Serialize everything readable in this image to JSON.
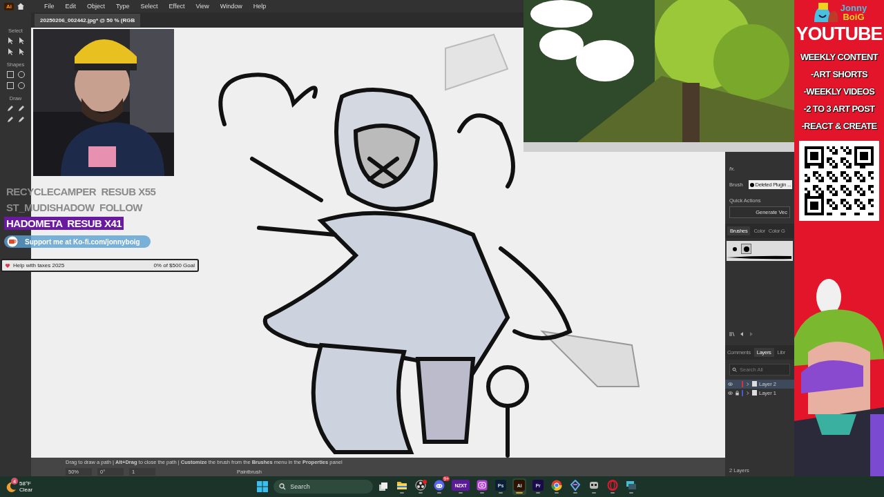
{
  "menu_bar": {
    "app_label": "Ai",
    "items": [
      "File",
      "Edit",
      "Object",
      "Type",
      "Select",
      "Effect",
      "View",
      "Window",
      "Help"
    ]
  },
  "document_tab": {
    "title": "20250206_002442.jpg* @ 50 % (RGB"
  },
  "toolbar": {
    "sections": [
      "Select",
      "Shapes",
      "Draw"
    ]
  },
  "chat_overlay": {
    "messages": [
      {
        "user": "RECYCLECAMPER",
        "action": "RESUB X55",
        "highlighted": false
      },
      {
        "user": "ST_MUDISHADOW",
        "action": "FOLLOW",
        "highlighted": false
      },
      {
        "user": "HADOMETA",
        "action": "RESUB X41",
        "highlighted": true
      }
    ]
  },
  "support_banner": {
    "text": "Support me at Ko-fi.com/jonnyboig"
  },
  "goal": {
    "title": "Help with taxes 2025",
    "progress": "0% of $500 Goal",
    "level": 0
  },
  "properties_panel": {
    "title": "fx.",
    "brush_label": "Brush",
    "brush_value": "Deleted Plugin ...",
    "quick_actions": "Quick Actions",
    "generate_button": "Generate Vec"
  },
  "brushes_panel": {
    "tabs": [
      {
        "label": "Brushes",
        "selected": true
      },
      {
        "label": "Color",
        "selected": false
      },
      {
        "label": "Color G",
        "selected": false
      }
    ],
    "swatches": [
      {
        "selected": false
      },
      {
        "selected": true
      }
    ]
  },
  "layers_panel": {
    "tabs": [
      {
        "label": "Comments",
        "selected": false
      },
      {
        "label": "Layers",
        "selected": true
      },
      {
        "label": "Libr",
        "selected": false
      }
    ],
    "search_placeholder": "Search All",
    "layers": [
      {
        "name": "Layer 2",
        "color": "#d8303c",
        "selected": true,
        "locked": false
      },
      {
        "name": "Layer 1",
        "color": "#4a58d0",
        "selected": false,
        "locked": true
      }
    ],
    "count": "2 Layers"
  },
  "status_bar": {
    "hint": "Drag to draw a path  |  **Alt+Drag** to close the path  |  **Customize** the brush from the **Brushes** menu in the **Properties** panel",
    "zoom": "50%",
    "rotation": "0°",
    "artboard": "1",
    "tool": "Paintbrush"
  },
  "banner": {
    "logo_top": "Jonny",
    "logo_bottom": "BoiG",
    "title": "YOUTUBE",
    "lines": [
      "WEEKLY CONTENT",
      "-ART SHORTS",
      "-WEEKLY VIDEOS",
      "-2 TO 3 ART POST",
      "-REACT & CREATE"
    ]
  },
  "taskbar": {
    "weather": {
      "temperature": "58°F",
      "condition": "Clear",
      "badge": "4"
    },
    "search_placeholder": "Search",
    "apps": [
      {
        "kind": "folder",
        "active": false
      },
      {
        "kind": "record",
        "active": false,
        "dot": true
      },
      {
        "kind": "chat",
        "active": false,
        "badge": "9+"
      },
      {
        "kind": "label",
        "label": "NZXT",
        "color": "#5a1a9a",
        "active": false
      },
      {
        "kind": "camera",
        "active": false
      },
      {
        "kind": "label",
        "label": "Ps",
        "color": "#0a1e36",
        "active": false
      },
      {
        "kind": "label",
        "label": "Ai",
        "color": "#2b1300",
        "active": true
      },
      {
        "kind": "label",
        "label": "Pr",
        "color": "#1a0a4a",
        "active": false
      },
      {
        "kind": "browser",
        "active": false
      },
      {
        "kind": "diamond",
        "active": false
      },
      {
        "kind": "robot",
        "active": false
      },
      {
        "kind": "ring",
        "active": false
      },
      {
        "kind": "screen",
        "active": false
      }
    ]
  }
}
